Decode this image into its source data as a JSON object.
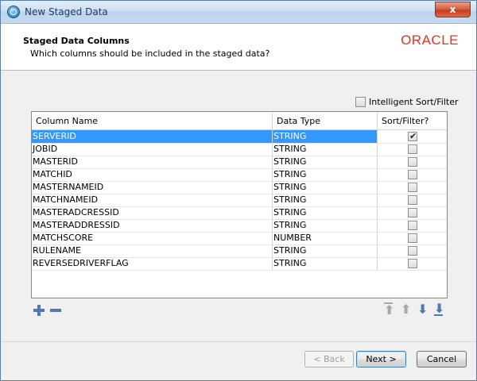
{
  "window": {
    "title": "New Staged Data",
    "close_symbol": "x"
  },
  "header": {
    "title": "Staged Data Columns",
    "subtitle": "Which columns should be included in the staged data?",
    "logo_text": "ORACLE"
  },
  "options": {
    "intelligent_label": "Intelligent Sort/Filter",
    "intelligent_checked": false
  },
  "table": {
    "columns": [
      "Column Name",
      "Data Type",
      "Sort/Filter?"
    ],
    "rows": [
      {
        "name": "SERVERID",
        "type": "STRING",
        "sort": true,
        "selected": true
      },
      {
        "name": "JOBID",
        "type": "STRING",
        "sort": false
      },
      {
        "name": "MASTERID",
        "type": "STRING",
        "sort": false
      },
      {
        "name": "MATCHID",
        "type": "STRING",
        "sort": false
      },
      {
        "name": "MASTERNAMEID",
        "type": "STRING",
        "sort": false
      },
      {
        "name": "MATCHNAMEID",
        "type": "STRING",
        "sort": false
      },
      {
        "name": "MASTERADCRESSID",
        "type": "STRING",
        "sort": false
      },
      {
        "name": "MASTERADDRESSID",
        "type": "STRING",
        "sort": false
      },
      {
        "name": "MATCHSCORE",
        "type": "NUMBER",
        "sort": false
      },
      {
        "name": "RULENAME",
        "type": "STRING",
        "sort": false
      },
      {
        "name": "REVERSEDRIVERFLAG",
        "type": "STRING",
        "sort": false
      }
    ]
  },
  "toolbar": {
    "icons": [
      "add-icon",
      "remove-icon",
      "move-top-icon",
      "move-up-icon",
      "move-down-icon",
      "move-bottom-icon"
    ]
  },
  "buttons": {
    "back": "< Back",
    "next": "Next >",
    "cancel": "Cancel"
  },
  "colors": {
    "selection": "#3399ff",
    "oracle_red": "#e5331f",
    "arrow_blue": "#4f7ab0"
  }
}
